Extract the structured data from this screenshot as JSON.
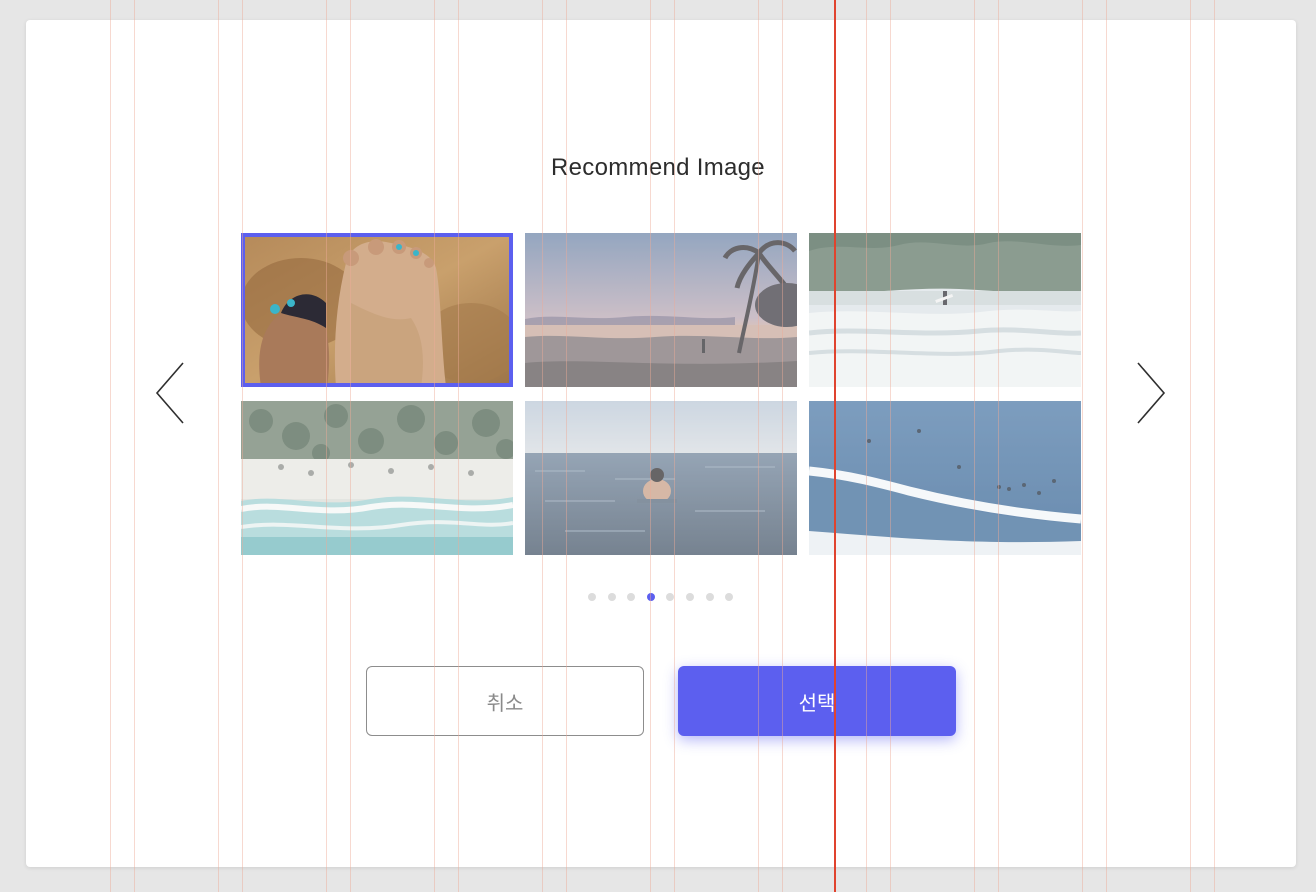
{
  "dialog": {
    "title": "Recommend Image",
    "prev_icon": "chevron-left-icon",
    "next_icon": "chevron-right-icon"
  },
  "gallery": {
    "selected_index": 0,
    "images": [
      {
        "subject": "feet-in-sand"
      },
      {
        "subject": "beach-sunset-palm"
      },
      {
        "subject": "surfer-shore-forest"
      },
      {
        "subject": "aerial-beach"
      },
      {
        "subject": "person-in-sea"
      },
      {
        "subject": "ocean-wave-surfers"
      }
    ]
  },
  "pagination": {
    "total": 8,
    "active": 4
  },
  "actions": {
    "cancel_label": "취소",
    "select_label": "선택"
  },
  "colors": {
    "accent": "#5c5fef",
    "guide": "#eeaa96",
    "guide_center": "#e0432e"
  }
}
